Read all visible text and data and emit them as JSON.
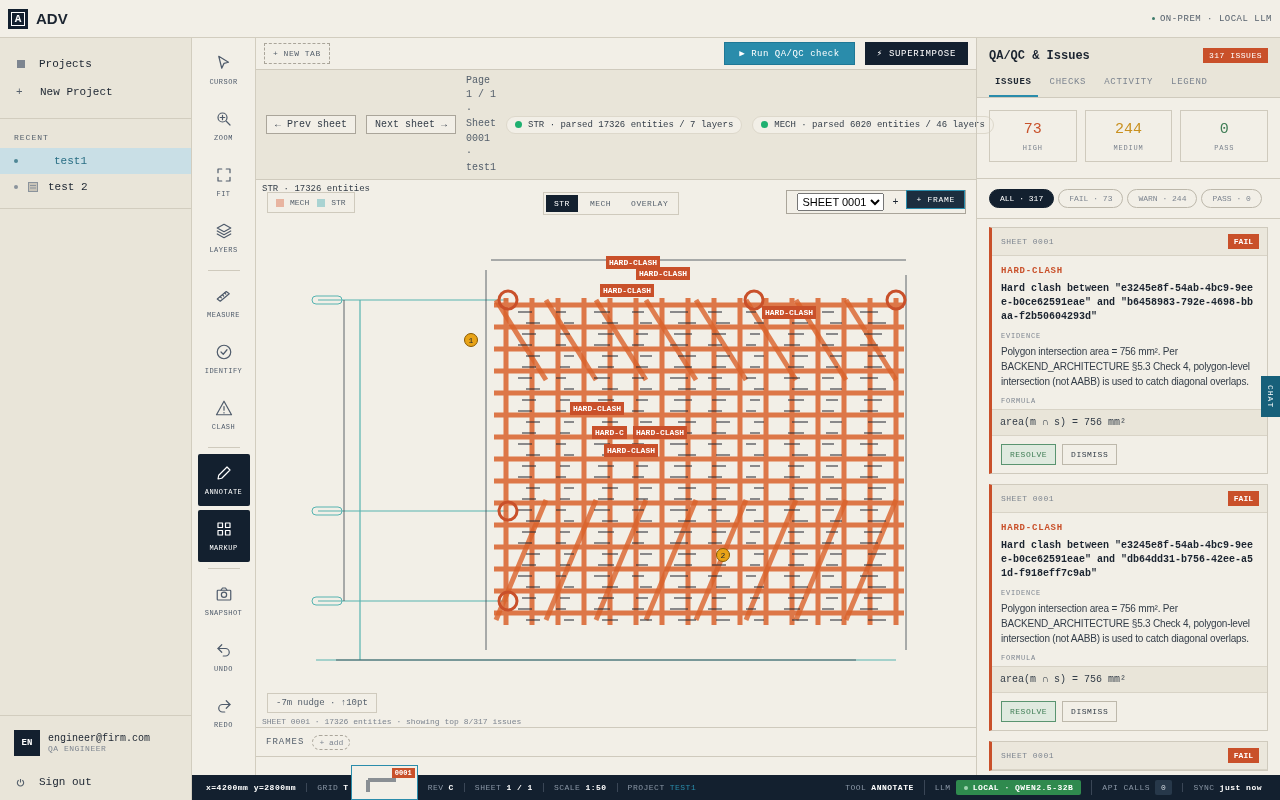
{
  "app": {
    "logo": "A",
    "name": "ADV",
    "mode": "ON-PREM · LOCAL LLM"
  },
  "sidebar": {
    "nav": [
      {
        "label": "Projects"
      },
      {
        "glyph": "+",
        "label": "New Project"
      }
    ],
    "recent_title": "RECENT",
    "recent": [
      {
        "label": "test1",
        "kind": "plain",
        "selected": true
      },
      {
        "label": "test 2",
        "kind": "sheet",
        "selected": false
      }
    ],
    "user": {
      "initials": "EN",
      "email": "engineer@firm.com",
      "role": "QA ENGINEER"
    },
    "sign_out": "Sign out"
  },
  "tools": [
    [
      {
        "label": "CURSOR",
        "selected": false
      },
      {
        "label": "ZOOM",
        "selected": false
      },
      {
        "label": "FIT",
        "selected": false
      },
      {
        "label": "LAYERS",
        "selected": false
      }
    ],
    [
      {
        "label": "MEASURE",
        "selected": false
      },
      {
        "label": "IDENTIFY",
        "selected": false
      },
      {
        "label": "CLASH",
        "selected": false
      }
    ],
    [
      {
        "label": "ANNOTATE",
        "selected": true
      },
      {
        "label": "MARKUP",
        "selected": true
      }
    ],
    [
      {
        "label": "SNAPSHOT",
        "selected": false
      },
      {
        "label": "UNDO",
        "selected": false
      },
      {
        "label": "REDO",
        "selected": false
      }
    ]
  ],
  "tabbar": {
    "new_tab": "+ NEW TAB",
    "run_glyph": "▶",
    "run": "Run QA/QC check",
    "superimpose_glyph": "⚡",
    "superimpose": "SUPERIMPOSE"
  },
  "sheetbar": {
    "prev": "← Prev sheet",
    "next": "Next sheet →",
    "page_info": "Page 1 / 1 · Sheet 0001 · test1",
    "parsed": [
      "STR · parsed 17326 entities / 7 layers",
      "MECH · parsed 6020 entities / 46 layers"
    ]
  },
  "canvas": {
    "entities_note": "STR · 17326 entities",
    "legend": [
      {
        "label": "MECH",
        "color": "#e8b4a0"
      },
      {
        "label": "STR",
        "color": "#a9d3d2"
      }
    ],
    "layers": [
      {
        "label": "STR",
        "selected": true
      },
      {
        "label": "MECH",
        "selected": false
      },
      {
        "label": "OVERLAY",
        "selected": false
      }
    ],
    "sheet_select": "SHEET 0001",
    "add": "+",
    "frame": "+ FRAME",
    "drawing": {
      "kind": "picture"
    },
    "clash_tags": [
      "HARD-CLASH",
      "HARD-CLASH",
      "HARD-CLASH",
      "HARD-CLASH",
      "HARD-CLASH",
      "HARD-C",
      "HARD-CLASH",
      "HARD-CLASH"
    ],
    "markers": [
      "1",
      "2"
    ],
    "nudge": "-7m nudge · ↑10pt",
    "footer": "SHEET 0001 · 17326 entities · showing top 8/317 issues"
  },
  "frames": {
    "label": "FRAMES",
    "add": "+ add",
    "thumbs": [
      {
        "badge": "0001"
      }
    ]
  },
  "panel": {
    "title": "QA/QC & Issues",
    "count": "317 ISSUES",
    "tabs": [
      {
        "label": "ISSUES",
        "selected": true
      },
      {
        "label": "CHECKS",
        "selected": false
      },
      {
        "label": "ACTIVITY",
        "selected": false
      },
      {
        "label": "LEGEND",
        "selected": false
      }
    ],
    "stats": [
      {
        "value": "73",
        "label": "HIGH",
        "color": "#c8512a"
      },
      {
        "value": "244",
        "label": "MEDIUM",
        "color": "#c9901f"
      },
      {
        "value": "0",
        "label": "PASS",
        "color": "#3f7d55"
      }
    ],
    "filters": [
      {
        "label": "ALL · 317",
        "selected": true
      },
      {
        "label": "FAIL · 73",
        "selected": false
      },
      {
        "label": "WARN · 244",
        "selected": false
      },
      {
        "label": "PASS · 0",
        "selected": false
      }
    ],
    "issues": [
      {
        "sheet": "SHEET 0001",
        "status": "FAIL",
        "type": "HARD-CLASH",
        "text": "Hard clash between \"e3245e8f-54ab-4bc9-9eee-b0ce62591eae\" and \"b6458983-792e-4698-bbaa-f2b50604293d\"",
        "evidence_label": "EVIDENCE",
        "evidence": "Polygon intersection area = 756 mm². Per BACKEND_ARCHITECTURE §5.3 Check 4, polygon-level intersection (not AABB) is used to catch diagonal overlaps.",
        "formula_label": "FORMULA",
        "formula": "area(m ∩ s) = 756 mm²",
        "actions": [
          "RESOLVE",
          "DISMISS"
        ]
      },
      {
        "sheet": "SHEET 0001",
        "status": "FAIL",
        "type": "HARD-CLASH",
        "text": "Hard clash between \"e3245e8f-54ab-4bc9-9eee-b0ce62591eae\" and \"db64dd31-b756-42ee-a51d-f918eff7c9ab\"",
        "evidence_label": "EVIDENCE",
        "evidence": "Polygon intersection area = 756 mm². Per BACKEND_ARCHITECTURE §5.3 Check 4, polygon-level intersection (not AABB) is used to catch diagonal overlaps.",
        "formula_label": "FORMULA",
        "formula": "area(m ∩ s) = 756 mm²",
        "actions": [
          "RESOLVE",
          "DISMISS"
        ]
      },
      {
        "sheet": "SHEET 0001",
        "status": "FAIL"
      }
    ],
    "chat": "CHAT"
  },
  "status_bar": {
    "left": [
      {
        "kind": "coord",
        "value": "x=4200mm y=2800mm"
      },
      {
        "kind": "text",
        "label": "GRID",
        "value": "T"
      },
      {
        "kind": "text",
        "label": "REV",
        "value": "C"
      },
      {
        "kind": "text",
        "label": "SHEET",
        "value": "1 / 1"
      },
      {
        "kind": "text",
        "label": "SCALE",
        "value": "1:50"
      },
      {
        "kind": "link",
        "label": "PROJECT",
        "value": "TEST1"
      }
    ],
    "right": [
      {
        "kind": "text",
        "label": "TOOL",
        "value": "ANNOTATE"
      },
      {
        "kind": "pill",
        "label": "LLM",
        "value": "LOCAL · QWEN2.5-32B"
      },
      {
        "kind": "count",
        "label": "API CALLS",
        "value": "0"
      },
      {
        "kind": "text",
        "label": "SYNC",
        "value": "just now"
      }
    ]
  }
}
